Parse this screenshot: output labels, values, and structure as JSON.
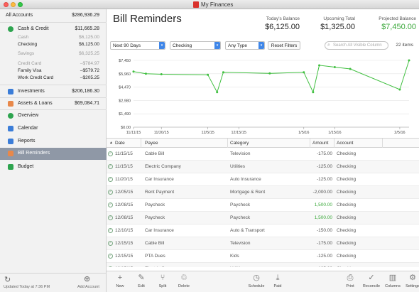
{
  "window": {
    "title": "My Finances"
  },
  "sidebar": {
    "all_accounts": {
      "label": "All Accounts",
      "value": "$286,936.29"
    },
    "cash_credit": {
      "label": "Cash & Credit",
      "value": "$11,665.28",
      "icon": "cash-icon"
    },
    "accounts": [
      {
        "label": "Cash",
        "value": "$6,125.00",
        "muted": true
      },
      {
        "label": "Checking",
        "value": "$6,125.00",
        "muted": false
      },
      {
        "label": "Savings",
        "value": "$6,325.25",
        "muted": true
      },
      {
        "label": "Credit Card",
        "value": "–$784.97",
        "muted": true
      },
      {
        "label": "Family Visa",
        "value": "–$579.72",
        "muted": false
      },
      {
        "label": "Work Credit Card",
        "value": "–$205.25",
        "muted": false
      }
    ],
    "investments": {
      "label": "Investments",
      "value": "$206,186.30"
    },
    "assets_loans": {
      "label": "Assets & Loans",
      "value": "$69,084.71"
    },
    "nav": [
      {
        "label": "Overview",
        "icon": "overview-icon",
        "color": "#2ea44f"
      },
      {
        "label": "Calendar",
        "icon": "calendar-icon",
        "color": "#3b7dd8"
      },
      {
        "label": "Reports",
        "icon": "reports-icon",
        "color": "#3b7dd8"
      },
      {
        "label": "Bill Reminders",
        "icon": "bill-reminders-icon",
        "color": "#e8884a"
      },
      {
        "label": "Budget",
        "icon": "budget-icon",
        "color": "#2ea44f"
      }
    ],
    "footer": {
      "updated": "Updated Today at 7:36 PM",
      "add_account": "Add Account"
    }
  },
  "header": {
    "title": "Bill Reminders",
    "kpis": [
      {
        "label": "Today's Balance",
        "value": "$6,125.00"
      },
      {
        "label": "Upcoming Total",
        "value": "$1,325.00"
      },
      {
        "label": "Projected Balance",
        "value": "$7,450.00"
      }
    ]
  },
  "filters": {
    "period": "Next 90 Days",
    "account": "Checking",
    "type": "Any Type",
    "reset_label": "Reset Filters",
    "search_placeholder": "Search All Visible Column",
    "items_count": "22 items"
  },
  "chart_data": {
    "type": "line",
    "x": [
      "11/11/15",
      "11/15/15",
      "11/20/15",
      "12/05/15",
      "12/08/15",
      "12/10/15",
      "12/25/15",
      "1/05/16",
      "1/08/16",
      "1/10/16",
      "1/15/16",
      "1/20/16",
      "2/05/16",
      "2/08/16"
    ],
    "values": [
      6200,
      5960,
      5900,
      5850,
      3900,
      6125,
      6000,
      6125,
      3900,
      6900,
      6700,
      6500,
      4200,
      7450
    ],
    "ytick_labels": [
      "$0.00",
      "$1,490",
      "$2,980",
      "$4,470",
      "$5,960",
      "$7,450"
    ],
    "ytick_values": [
      0,
      1490,
      2980,
      4470,
      5960,
      7450
    ],
    "xtick_labels": [
      "11/11/15",
      "11/20/15",
      "12/5/15",
      "12/15/15",
      "1/5/16",
      "1/15/16",
      "2/5/16"
    ],
    "xtick_values": [
      "11/11/15",
      "11/20/15",
      "12/05/15",
      "12/15/15",
      "1/05/16",
      "1/15/16",
      "2/05/16"
    ],
    "ylim": [
      0,
      7450
    ],
    "color": "#3fbf3f",
    "grid": true
  },
  "table": {
    "columns": [
      "Date",
      "Payee",
      "Category",
      "Amount",
      "Account"
    ],
    "rows": [
      {
        "date": "11/15/15",
        "payee": "Cable Bill",
        "category": "Television",
        "amount": "-175.00",
        "account": "Checking",
        "positive": false
      },
      {
        "date": "11/15/15",
        "payee": "Electric Company",
        "category": "Utilities",
        "amount": "-125.00",
        "account": "Checking",
        "positive": false
      },
      {
        "date": "11/20/15",
        "payee": "Car Insurance",
        "category": "Auto Insurance",
        "amount": "-125.00",
        "account": "Checking",
        "positive": false
      },
      {
        "date": "12/05/15",
        "payee": "Rent Payment",
        "category": "Mortgage & Rent",
        "amount": "-2,000.00",
        "account": "Checking",
        "positive": false
      },
      {
        "date": "12/08/15",
        "payee": "Paycheck",
        "category": "Paycheck",
        "amount": "1,500.00",
        "account": "Checking",
        "positive": true
      },
      {
        "date": "12/08/15",
        "payee": "Paycheck",
        "category": "Paycheck",
        "amount": "1,500.00",
        "account": "Checking",
        "positive": true
      },
      {
        "date": "12/10/15",
        "payee": "Car Insurance",
        "category": "Auto & Transport",
        "amount": "-150.00",
        "account": "Checking",
        "positive": false
      },
      {
        "date": "12/15/15",
        "payee": "Cable Bill",
        "category": "Television",
        "amount": "-175.00",
        "account": "Checking",
        "positive": false
      },
      {
        "date": "12/15/15",
        "payee": "PTA Dues",
        "category": "Kids",
        "amount": "-125.00",
        "account": "Checking",
        "positive": false
      },
      {
        "date": "12/15/15",
        "payee": "Electric Company",
        "category": "Utilities",
        "amount": "-125.00",
        "account": "Checking",
        "positive": false
      }
    ]
  },
  "toolbar": [
    {
      "label": "New",
      "icon": "plus-icon"
    },
    {
      "label": "Edit",
      "icon": "pencil-icon"
    },
    {
      "label": "Split",
      "icon": "split-icon"
    },
    {
      "label": "Delete",
      "icon": "trash-icon"
    },
    {
      "label": "Schedule",
      "icon": "clock-icon"
    },
    {
      "label": "Paid",
      "icon": "paid-icon"
    },
    {
      "label": "Print",
      "icon": "printer-icon"
    },
    {
      "label": "Reconcile",
      "icon": "checkmark-icon"
    },
    {
      "label": "Columns",
      "icon": "columns-icon"
    },
    {
      "label": "Settings",
      "icon": "gear-icon"
    }
  ]
}
